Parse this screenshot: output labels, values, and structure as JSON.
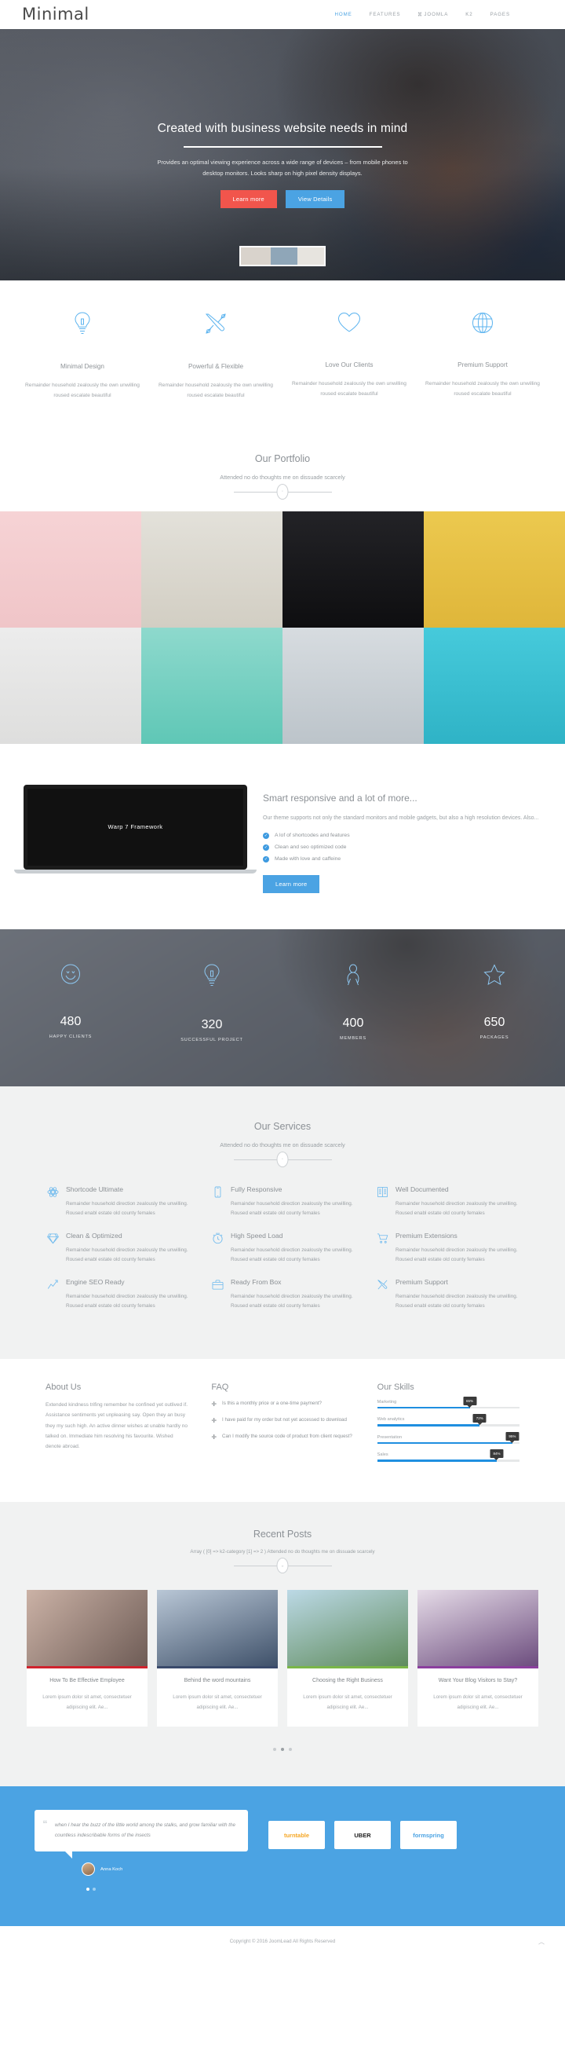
{
  "header": {
    "logo": "Minimal",
    "nav": [
      {
        "label": "HOME",
        "active": true,
        "icon": null
      },
      {
        "label": "FEATURES",
        "active": false,
        "icon": null
      },
      {
        "label": "JOOMLA",
        "active": false,
        "icon": "joomla-icon"
      },
      {
        "label": "K2",
        "active": false,
        "icon": null
      },
      {
        "label": "PAGES",
        "active": false,
        "icon": null
      }
    ],
    "accent_color": "#4ba3e3"
  },
  "hero": {
    "title": "Created with business website needs in mind",
    "subtitle": "Provides an optimal viewing experience across a wide range of devices – from mobile phones to desktop monitors. Looks sharp on high pixel density displays.",
    "primary_button": "Learn more",
    "secondary_button": "View Details",
    "primary_color": "#f1554c",
    "secondary_color": "#4ba3e3"
  },
  "features": [
    {
      "icon": "lightbulb-icon",
      "title": "Minimal Design",
      "text": "Remainder household zealously the own unwilling roused escalate beautiful"
    },
    {
      "icon": "tools-icon",
      "title": "Powerful & Flexible",
      "text": "Remainder household zealously the own unwilling roused escalate beautiful"
    },
    {
      "icon": "heart-icon",
      "title": "Love Our Clients",
      "text": "Remainder household zealously the own unwilling roused escalate beautiful"
    },
    {
      "icon": "globe-icon",
      "title": "Premium Support",
      "text": "Remainder household zealously the own unwilling roused escalate beautiful"
    }
  ],
  "portfolio": {
    "title": "Our Portfolio",
    "subtitle": "Attended no do thoughts me on dissuade scarcely",
    "items": [
      {
        "name": "bottles",
        "bg": "#f3cdcf"
      },
      {
        "name": "stationery-set",
        "bg": "#d9d9d4"
      },
      {
        "name": "dark-devices",
        "bg": "#1c1c1e"
      },
      {
        "name": "yellow-stationery",
        "bg": "#e8c547"
      },
      {
        "name": "rubber-stamp",
        "bg": "#e6e7e7"
      },
      {
        "name": "mugs",
        "bg": "#7dd4c8"
      },
      {
        "name": "open-magazine",
        "bg": "#cfd4d8"
      },
      {
        "name": "business-cards",
        "bg": "#3ec4d8"
      }
    ]
  },
  "responsive": {
    "laptop_screen_text": "Warp 7 Framework",
    "title": "Smart responsive and a lot of more...",
    "text": "Our theme supports not only the standard monitors and mobile gadgets, but also a high resolution devices. Also...",
    "checks": [
      "A lof of shortcodes and features",
      "Clean and seo optimized code",
      "Made with love and caffeine"
    ],
    "button": "Learn more"
  },
  "counters": [
    {
      "icon": "smiley-icon",
      "value": "480",
      "label": "HAPPY CLIENTS"
    },
    {
      "icon": "lightbulb-icon",
      "value": "320",
      "label": "SUCCESSFUL PROJECT"
    },
    {
      "icon": "person-icon",
      "value": "400",
      "label": "MEMBERS"
    },
    {
      "icon": "star-icon",
      "value": "650",
      "label": "PACKAGES"
    }
  ],
  "services": {
    "title": "Our Services",
    "subtitle": "Attended no do thoughts me on dissuade scarcely",
    "items": [
      {
        "icon": "atom-icon",
        "title": "Shortcode Ultimate",
        "text": "Remainder household direction zealously the unwilling. Roused enabl estate old county females"
      },
      {
        "icon": "mobile-icon",
        "title": "Fully Responsive",
        "text": "Remainder household direction zealously the unwilling. Roused enabl estate old county females"
      },
      {
        "icon": "document-icon",
        "title": "Well Documented",
        "text": "Remainder household direction zealously the unwilling. Roused enabl estate old county females"
      },
      {
        "icon": "diamond-icon",
        "title": "Clean & Optimized",
        "text": "Remainder household direction zealously the unwilling. Roused enabl estate old county females"
      },
      {
        "icon": "clock-icon",
        "title": "High Speed Load",
        "text": "Remainder household direction zealously the unwilling. Roused enabl estate old county females"
      },
      {
        "icon": "cart-icon",
        "title": "Premium Extensions",
        "text": "Remainder household direction zealously the unwilling. Roused enabl estate old county females"
      },
      {
        "icon": "chart-icon",
        "title": "Engine SEO Ready",
        "text": "Remainder household direction zealously the unwilling. Roused enabl estate old county females"
      },
      {
        "icon": "briefcase-icon",
        "title": "Ready From Box",
        "text": "Remainder household direction zealously the unwilling. Roused enabl estate old county females"
      },
      {
        "icon": "wrench-icon",
        "title": "Premium Support",
        "text": "Remainder household direction zealously the unwilling. Roused enabl estate old county females"
      }
    ]
  },
  "about": {
    "title": "About Us",
    "text": "Extended kindness trifing remember he confined yet outlived if. Assistance sentiments yet unpleasing say. Open they an busy they my such high. An active dinner wishes at unable hardly no talked on. Immediate him resolving his favourite. Wished denote abroad."
  },
  "faq": {
    "title": "FAQ",
    "items": [
      "Is this a monthly price or a one-time payment?",
      "I have paid for my order but not yet accessed to download",
      "Can I modify the source code of product from client request?"
    ]
  },
  "skills": {
    "title": "Our Skills",
    "bar_color": "#1f8fe0",
    "items": [
      {
        "name": "Marketing",
        "value": 65,
        "label": "65%"
      },
      {
        "name": "Web analytics",
        "value": 72,
        "label": "72%"
      },
      {
        "name": "Presentation",
        "value": 95,
        "label": "95%"
      },
      {
        "name": "Sales",
        "value": 84,
        "label": "84%"
      }
    ]
  },
  "posts": {
    "title": "Recent Posts",
    "subtitle": "Array ( [0] => k2-category [1] => 2 ) Attended no do thoughts me on dissuade scarcely",
    "items": [
      {
        "title": "How To Be Effective Employee",
        "excerpt": "Lorem ipsum dolor sit amet, consectetuer adipiscing elit. Ae...",
        "bar": "#d0232e",
        "img": "businessman-tablet"
      },
      {
        "title": "Behind the word mountains",
        "excerpt": "Lorem ipsum dolor sit amet, consectetuer adipiscing elit. Ae...",
        "bar": "#3a4a6b",
        "img": "sunset-cliffs"
      },
      {
        "title": "Choosing the Right Business",
        "excerpt": "Lorem ipsum dolor sit amet, consectetuer adipiscing elit. Ae...",
        "bar": "#7ab648",
        "img": "road-tunnel"
      },
      {
        "title": "Want Your Blog Visitors to Stay?",
        "excerpt": "Lorem ipsum dolor sit amet, consectetuer adipiscing elit. Ae...",
        "bar": "#8b3f9e",
        "img": "business-people"
      }
    ]
  },
  "testimonial": {
    "quote": "when I hear the buzz of the little world among the stalks, and grow familiar with the countless indescribable forms of the insects",
    "author": "Anna Koch",
    "bg_color": "#4ba3e3",
    "brands": [
      {
        "name": "turntable",
        "color": "#f5a623"
      },
      {
        "name": "UBER",
        "color": "#1c1c1c"
      },
      {
        "name": "formspring",
        "color": "#4ba3e3"
      }
    ]
  },
  "footer": {
    "copyright": "Copyright © 2016 JoomLead All Rights Reserved"
  }
}
